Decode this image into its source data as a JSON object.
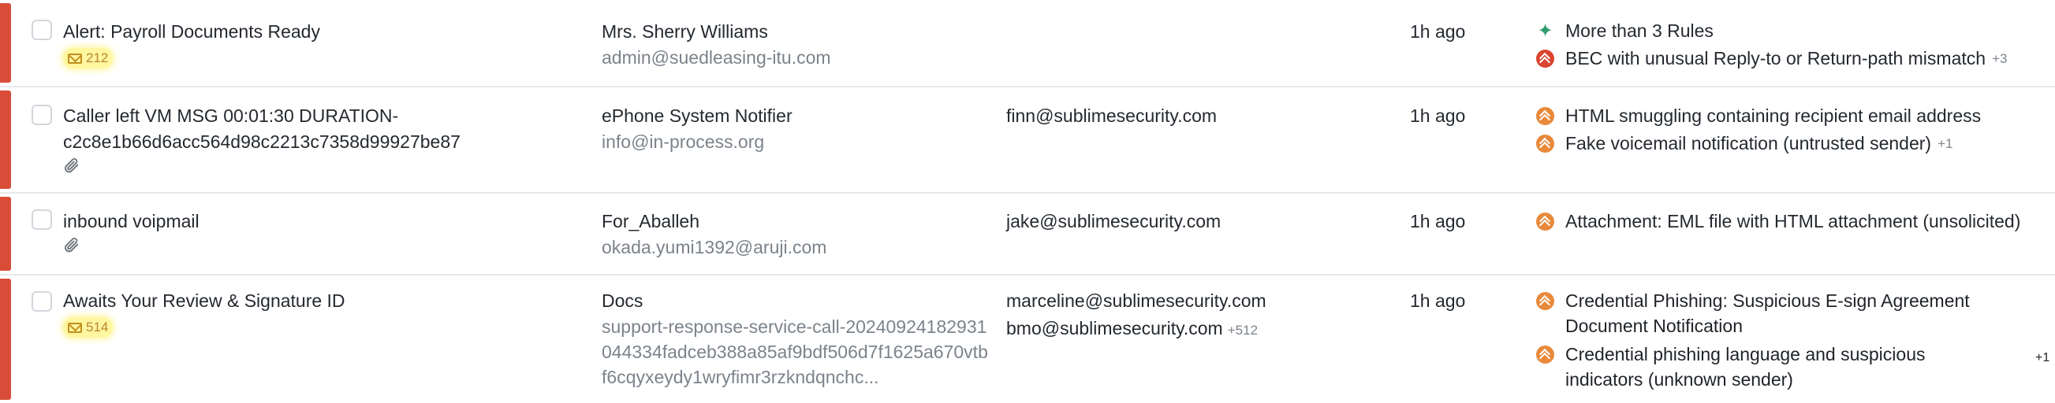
{
  "rows": [
    {
      "subject_line1": "Alert: Payroll Documents Ready",
      "subject_line2": "",
      "badge_count": "212",
      "sender_name": "Mrs. Sherry Williams",
      "sender_email": "admin@suedleasing-itu.com",
      "recipient_line1": "",
      "recipient_line2": "",
      "recipient_more": "",
      "time": "1h ago",
      "rules": [
        {
          "text": "More than 3 Rules",
          "icon": "sparkle-icon",
          "more": ""
        },
        {
          "text": "BEC with unusual Reply-to or Return-path mismatch",
          "icon": "severity-high-icon",
          "more": "+3"
        }
      ]
    },
    {
      "subject_line1": "Caller left VM MSG 00:01:30 DURATION-",
      "subject_line2": "c2c8e1b66d6acc564d98c2213c7358d99927be87",
      "badge_count": "",
      "sender_name": "ePhone System Notifier",
      "sender_email": "info@in-process.org",
      "recipient_line1": "finn@sublimesecurity.com",
      "recipient_line2": "",
      "recipient_more": "",
      "time": "1h ago",
      "rules": [
        {
          "text": "HTML smuggling containing recipient email address",
          "icon": "severity-medium-icon",
          "more": ""
        },
        {
          "text": "Fake voicemail notification (untrusted sender)",
          "icon": "severity-medium-icon",
          "more": "+1"
        }
      ]
    },
    {
      "subject_line1": "inbound voipmail",
      "subject_line2": "",
      "badge_count": "",
      "sender_name": "For_Aballeh",
      "sender_email": "okada.yumi1392@aruji.com",
      "recipient_line1": "jake@sublimesecurity.com",
      "recipient_line2": "",
      "recipient_more": "",
      "time": "1h ago",
      "rules": [
        {
          "text": "Attachment: EML file with HTML attachment (unsolicited)",
          "icon": "severity-medium-icon",
          "more": ""
        }
      ]
    },
    {
      "subject_line1": "Awaits Your Review & Signature ID",
      "subject_line2": "",
      "badge_count": "514",
      "sender_name": "Docs",
      "sender_email": "support-response-service-call-20240924182931044334fadceb388a85af9bdf506d7f1625a670vtbf6cqyxeydy1wryfimr3rzkndqnchc...",
      "recipient_line1": "marceline@sublimesecurity.com",
      "recipient_line2": "bmo@sublimesecurity.com",
      "recipient_more": "+512",
      "time": "1h ago",
      "rules": [
        {
          "text": "Credential Phishing: Suspicious E-sign Agreement",
          "text2": "Document Notification",
          "icon": "severity-medium-icon",
          "more": ""
        },
        {
          "text": "Credential phishing language and suspicious",
          "text2": "indicators (unknown sender)",
          "icon": "severity-medium-icon",
          "more": "+1"
        }
      ]
    }
  ]
}
